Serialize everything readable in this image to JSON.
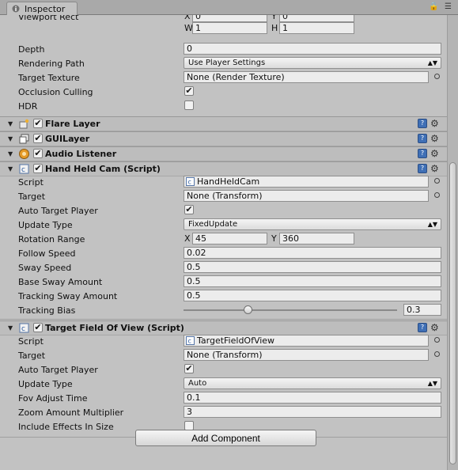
{
  "window": {
    "tab_label": "Inspector",
    "tab_icon": "info-icon",
    "tab_tools": "🔒 ☰"
  },
  "camera": {
    "viewport_rect": {
      "label": "Viewport Rect",
      "x_label": "X",
      "x": "0",
      "y_label": "Y",
      "y": "0",
      "w_label": "W",
      "w": "1",
      "h_label": "H",
      "h": "1"
    },
    "depth": {
      "label": "Depth",
      "value": "0"
    },
    "rendering_path": {
      "label": "Rendering Path",
      "value": "Use Player Settings"
    },
    "target_texture": {
      "label": "Target Texture",
      "value": "None (Render Texture)"
    },
    "occlusion_culling": {
      "label": "Occlusion Culling",
      "checked": true
    },
    "hdr": {
      "label": "HDR",
      "checked": false
    }
  },
  "components": {
    "flare_layer": {
      "title": "Flare Layer",
      "enabled": true
    },
    "gui_layer": {
      "title": "GUILayer",
      "enabled": true
    },
    "audio_listener": {
      "title": "Audio Listener",
      "enabled": true
    }
  },
  "hand_held_cam": {
    "title": "Hand Held Cam (Script)",
    "enabled": true,
    "script": {
      "label": "Script",
      "value": "HandHeldCam"
    },
    "target": {
      "label": "Target",
      "value": "None (Transform)"
    },
    "auto_target_player": {
      "label": "Auto Target Player",
      "checked": true
    },
    "update_type": {
      "label": "Update Type",
      "value": "FixedUpdate"
    },
    "rotation_range": {
      "label": "Rotation Range",
      "x_label": "X",
      "x": "45",
      "y_label": "Y",
      "y": "360"
    },
    "follow_speed": {
      "label": "Follow Speed",
      "value": "0.02"
    },
    "sway_speed": {
      "label": "Sway Speed",
      "value": "0.5"
    },
    "base_sway_amount": {
      "label": "Base Sway Amount",
      "value": "0.5"
    },
    "tracking_sway_amount": {
      "label": "Tracking Sway Amount",
      "value": "0.5"
    },
    "tracking_bias": {
      "label": "Tracking Bias",
      "value": "0.3",
      "slider_fraction": 0.3
    }
  },
  "target_fov": {
    "title": "Target Field Of View (Script)",
    "enabled": true,
    "script": {
      "label": "Script",
      "value": "TargetFieldOfView"
    },
    "target": {
      "label": "Target",
      "value": "None (Transform)"
    },
    "auto_target_player": {
      "label": "Auto Target Player",
      "checked": true
    },
    "update_type": {
      "label": "Update Type",
      "value": "Auto"
    },
    "fov_adjust_time": {
      "label": "Fov Adjust Time",
      "value": "0.1"
    },
    "zoom_amount_multiplier": {
      "label": "Zoom Amount Multiplier",
      "value": "3"
    },
    "include_effects_in_size": {
      "label": "Include Effects In Size",
      "checked": false
    }
  },
  "footer": {
    "add_component_label": "Add Component"
  },
  "colors": {
    "help_icon": "#3f6fb5",
    "panel_bg": "#c2c2c2"
  }
}
